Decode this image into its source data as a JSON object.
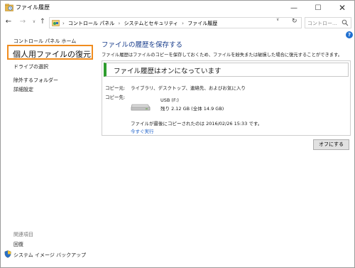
{
  "window": {
    "title": "ファイル履歴",
    "minimize_label": "—",
    "maximize_label": "☐",
    "close_label": "✕"
  },
  "address_bar": {
    "back_glyph": "←",
    "forward_glyph": "→",
    "recent_glyph": "∨",
    "up_glyph": "↑",
    "breadcrumbs": [
      "コントロール パネル",
      "システムとセキュリティ",
      "ファイル履歴"
    ],
    "crumb_separator": "›",
    "leading_separator": "›",
    "dropdown_glyph": "∨",
    "refresh_glyph": "↻"
  },
  "search": {
    "placeholder": "コントロー..."
  },
  "sidebar": {
    "home": "コントロール パネル ホーム",
    "restore_personal_files": "個人用ファイルの復元",
    "select_drive": "ドライブの選択",
    "exclude_folders": "除外するフォルダー",
    "advanced_settings": "詳細設定",
    "related_heading": "関連項目",
    "recovery": "回復",
    "system_image_backup": "システム イメージ バックアップ"
  },
  "main": {
    "help_glyph": "?",
    "heading": "ファイルの履歴を保存する",
    "description": "ファイル履歴はファイルのコピーを保存しておくため、ファイルを紛失または破損した場合に復元することができます。",
    "status": "ファイル履歴はオンになっています",
    "copy_from_label": "コピー元:",
    "copy_from_value": "ライブラリ、デスクトップ、連絡先、およびお気に入り",
    "copy_to_label": "コピー先:",
    "drive_name": "USB (F:)",
    "drive_space": "残り 2.12 GB (全体 14.9 GB)",
    "last_copied": "ファイルが最後にコピーされたのは 2016/02/26 15:33 です。",
    "run_now": "今すぐ実行",
    "off_button": "オフにする"
  },
  "colors": {
    "highlight_border": "#f08c1e",
    "status_accent": "#2e9d2e",
    "heading_blue": "#1a3e8c",
    "link_blue": "#1a5ec8"
  },
  "icons": [
    "file-history-icon",
    "control-panel-icon",
    "search-icon",
    "refresh-icon",
    "help-icon",
    "usb-drive-icon",
    "uac-shield-icon"
  ]
}
